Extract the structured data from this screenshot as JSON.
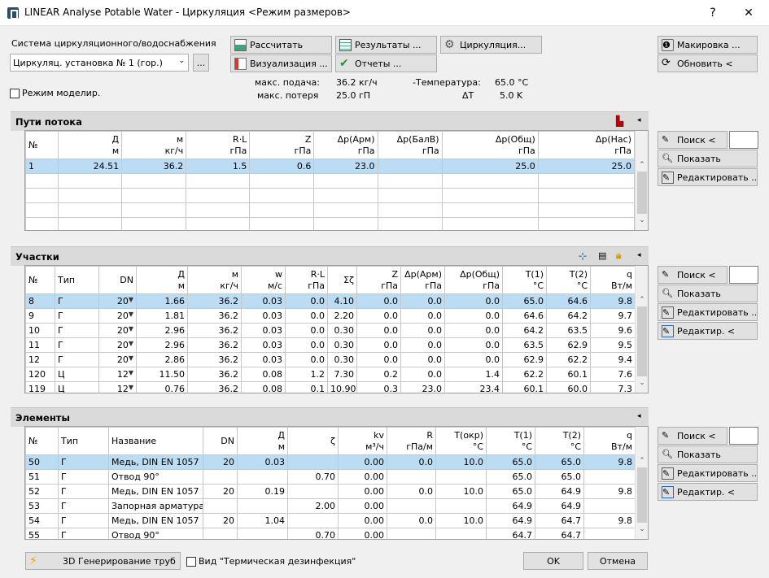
{
  "window": {
    "title": "LINEAR Analyse Potable Water - Циркуляция <Режим размеров>",
    "help": "?",
    "close": "✕"
  },
  "system": {
    "label": "Система циркуляционного/водоснабжения",
    "selected": "Циркуляц. установка № 1 (гор.)",
    "browse": "...",
    "mode_label": "Режим моделир."
  },
  "toolbar": {
    "calc": "Рассчитать",
    "results": "Результаты ...",
    "circ": "Циркуляция...",
    "visual": "Визуализация ...",
    "reports": "Отчеты ...",
    "marking": "Макировка ...",
    "refresh": "Обновить <"
  },
  "stats": {
    "max_flow_label": "макс. подача:",
    "max_flow": "36.2 кг/ч",
    "max_loss_label": "макс. потеря",
    "max_loss": "25.0 гП",
    "temp_label": "-Температура:",
    "temp": "65.0  °C",
    "dt_label": "ΔT",
    "dt": "5.0  K"
  },
  "flow": {
    "title": "Пути потока",
    "cols": [
      [
        "№",
        ""
      ],
      [
        "Д",
        "м"
      ],
      [
        "м",
        "кг/ч"
      ],
      [
        "R·L",
        "гПа"
      ],
      [
        "Z",
        "гПа"
      ],
      [
        "Δp(Арм)",
        "гПа"
      ],
      [
        "Δp(БалВ)",
        "гПа"
      ],
      [
        "Δp(Общ)",
        "гПа"
      ],
      [
        "Δp(Нас)",
        "гПа"
      ]
    ],
    "rows": [
      [
        "1",
        "24.51",
        "36.2",
        "1.5",
        "0.6",
        "23.0",
        "",
        "25.0",
        "25.0"
      ]
    ]
  },
  "parts": {
    "title": "Участки",
    "cols": [
      [
        "№",
        ""
      ],
      [
        "Тип",
        ""
      ],
      [
        "DN",
        ""
      ],
      [
        "Д",
        "м"
      ],
      [
        "м",
        "кг/ч"
      ],
      [
        "w",
        "м/с"
      ],
      [
        "R·L",
        "гПа"
      ],
      [
        "Σζ",
        ""
      ],
      [
        "Z",
        "гПа"
      ],
      [
        "Δp(Арм)",
        "гПа"
      ],
      [
        "Δp(Общ)",
        "гПа"
      ],
      [
        "T(1)",
        "°C"
      ],
      [
        "T(2)",
        "°C"
      ],
      [
        "q",
        "Вт/м"
      ]
    ],
    "rows": [
      [
        "8",
        "Г",
        "20",
        "1.66",
        "36.2",
        "0.03",
        "0.0",
        "4.10",
        "0.0",
        "0.0",
        "0.0",
        "65.0",
        "64.6",
        "9.8"
      ],
      [
        "9",
        "Г",
        "20",
        "1.81",
        "36.2",
        "0.03",
        "0.0",
        "2.20",
        "0.0",
        "0.0",
        "0.0",
        "64.6",
        "64.2",
        "9.7"
      ],
      [
        "10",
        "Г",
        "20",
        "2.96",
        "36.2",
        "0.03",
        "0.0",
        "0.30",
        "0.0",
        "0.0",
        "0.0",
        "64.2",
        "63.5",
        "9.6"
      ],
      [
        "11",
        "Г",
        "20",
        "2.96",
        "36.2",
        "0.03",
        "0.0",
        "0.30",
        "0.0",
        "0.0",
        "0.0",
        "63.5",
        "62.9",
        "9.5"
      ],
      [
        "12",
        "Г",
        "20",
        "2.86",
        "36.2",
        "0.03",
        "0.0",
        "0.30",
        "0.0",
        "0.0",
        "0.0",
        "62.9",
        "62.2",
        "9.4"
      ],
      [
        "120",
        "Ц",
        "12",
        "11.50",
        "36.2",
        "0.08",
        "1.2",
        "7.30",
        "0.2",
        "0.0",
        "1.4",
        "62.2",
        "60.1",
        "7.6"
      ],
      [
        "119",
        "Ц",
        "12",
        "0.76",
        "36.2",
        "0.08",
        "0.1",
        "10.90",
        "0.3",
        "23.0",
        "23.4",
        "60.1",
        "60.0",
        "7.3"
      ]
    ]
  },
  "elements": {
    "title": "Элементы",
    "cols": [
      [
        "№",
        ""
      ],
      [
        "Тип",
        ""
      ],
      [
        "Название",
        ""
      ],
      [
        "DN",
        ""
      ],
      [
        "Д",
        "м"
      ],
      [
        "ζ",
        ""
      ],
      [
        "kv",
        "м³/ч"
      ],
      [
        "R",
        "гПа/м"
      ],
      [
        "T(окр)",
        "°C"
      ],
      [
        "T(1)",
        "°C"
      ],
      [
        "T(2)",
        "°C"
      ],
      [
        "q",
        "Вт/м"
      ]
    ],
    "rows": [
      [
        "50",
        "Г",
        "Медь, DIN EN 1057",
        "20",
        "0.03",
        "",
        "0.00",
        "0.0",
        "10.0",
        "65.0",
        "65.0",
        "9.8"
      ],
      [
        "51",
        "Г",
        "Отвод 90°",
        "",
        "",
        "0.70",
        "0.00",
        "",
        "",
        "65.0",
        "65.0",
        ""
      ],
      [
        "52",
        "Г",
        "Медь, DIN EN 1057",
        "20",
        "0.19",
        "",
        "0.00",
        "0.0",
        "10.0",
        "65.0",
        "64.9",
        "9.8"
      ],
      [
        "53",
        "Г",
        "Запорная арматура,...",
        "",
        "",
        "2.00",
        "0.00",
        "",
        "",
        "64.9",
        "64.9",
        ""
      ],
      [
        "54",
        "Г",
        "Медь, DIN EN 1057",
        "20",
        "1.04",
        "",
        "0.00",
        "0.0",
        "10.0",
        "64.9",
        "64.7",
        "9.8"
      ],
      [
        "55",
        "Г",
        "Отвод 90°",
        "",
        "",
        "0.70",
        "0.00",
        "",
        "",
        "64.7",
        "64.7",
        ""
      ]
    ]
  },
  "side": {
    "search": "Поиск <",
    "show": "Показать",
    "edit": "Редактировать ...",
    "edit2": "Редактир. <"
  },
  "bottom": {
    "gen3d": "3D Генерирование труб",
    "view": "Вид \"Термическая дезинфекция\"",
    "ok": "OK",
    "cancel": "Отмена"
  }
}
